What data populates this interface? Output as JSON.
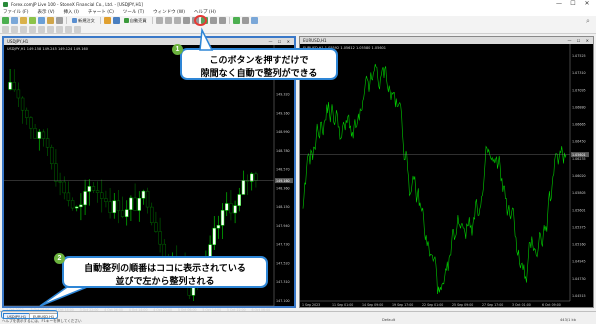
{
  "window": {
    "title": "Forex.comJP Live 100 - StoneX Financial Co., Ltd. - [USDJPY,H1]",
    "minimize": "—",
    "maximize": "☐",
    "close": "✕"
  },
  "menu": [
    "ファイル (F)",
    "表示 (V)",
    "挿入 (I)",
    "チャート (C)",
    "ツール (T)",
    "ウィンドウ (W)",
    "ヘルプ (H)"
  ],
  "toolbar": {
    "new_order": "新規注文",
    "autotrade": "自動売買"
  },
  "chart_left": {
    "title": "USDJPY,H1",
    "info": "USDJPY,H1  149.158 149.245 149.124 149.160",
    "price_labels": [
      "149.740",
      "149.530",
      "149.320",
      "149.160",
      "148.990",
      "148.780",
      "148.570",
      "148.360",
      "148.150",
      "147.940",
      "147.730",
      "147.520",
      "147.310",
      "147.100"
    ],
    "current_price": "149.160",
    "time_labels": [
      "3 Oct 2023",
      "3 Oct 06:00",
      "3 Oct 14:00",
      "3 Oct 22:00",
      "4 Oct 06:00",
      "4 Oct 14:00",
      "4 Oct 22:00",
      "5 Oct 06:00",
      "5 Oct 14:00",
      "5 Oct 22:00",
      "6 Oct 06:00"
    ]
  },
  "chart_right": {
    "title": "EURUSD,H1",
    "info": "EURUSD,H1  1.05592 1.05612 1.05580 1.05601",
    "price_labels": [
      "1.07525",
      "1.07310",
      "1.07095",
      "1.06880",
      "1.06665",
      "1.06450",
      "1.06235",
      "1.06020",
      "1.05805",
      "1.05601",
      "1.05375",
      "1.05160",
      "1.04945",
      "1.04730",
      "1.04515"
    ],
    "current_price": "1.05601",
    "time_labels": [
      "1 Sep 2023",
      "11 Sep 01:00",
      "14 Sep 09:00",
      "19 Sep 17:00",
      "22 Sep 01:00",
      "25 Sep 09:00",
      "27 Sep 17:00",
      "3 Oct 01:00",
      "6 Oct 09:00"
    ]
  },
  "tabs": [
    "USDJPY,H1",
    "EURUSD,H1"
  ],
  "status": {
    "help": "ヘルプを表示するには、F1キーを押してください",
    "profile": "Default",
    "connection": "443/1 kb"
  },
  "callouts": {
    "top": {
      "number": "1",
      "line1": "このボタンを押すだけで",
      "line2": "隙間なく自動で整列ができる"
    },
    "bottom": {
      "number": "2",
      "line1": "自動整列の順番はココに表示されている",
      "line2": "並びで左から整列される"
    }
  },
  "colors": {
    "bull": "#00e000",
    "bear": "#006a00",
    "line": "#00d000",
    "accent": "#2e86d6",
    "badge": "#6cb33e",
    "ring": "#e53935"
  }
}
